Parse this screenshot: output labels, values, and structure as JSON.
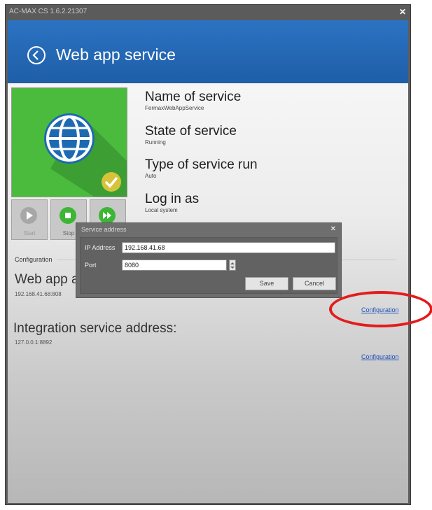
{
  "window": {
    "title": "AC-MAX CS 1.6.2.21307",
    "close": "✕"
  },
  "header": {
    "title": "Web app service"
  },
  "service": {
    "name_label": "Name of service",
    "name_value": "FermaxWebAppService",
    "state_label": "State of service",
    "state_value": "Running",
    "run_label": "Type of service run",
    "run_value": "Auto",
    "login_label": "Log in as",
    "login_value": "Local system"
  },
  "controls": {
    "start": "Start",
    "stop": "Stop"
  },
  "config": {
    "section_label": "Configuration",
    "web_label": "Web app a",
    "web_value": "192.168.41.68:808",
    "web_link": "Configuration",
    "integration_label": "Integration service address:",
    "integration_value": "127.0.0.1:8892",
    "integration_link": "Configuration"
  },
  "dialog": {
    "title": "Service address",
    "close": "✕",
    "ip_label": "IP Address",
    "ip_value": "192.168.41.68",
    "port_label": "Port",
    "port_value": "8080",
    "save": "Save",
    "cancel": "Cancel"
  },
  "colors": {
    "header_blue": "#2b73c2",
    "tile_green": "#4bbb3d",
    "highlight_red": "#e31c1c",
    "link_blue": "#1f4fb8"
  }
}
